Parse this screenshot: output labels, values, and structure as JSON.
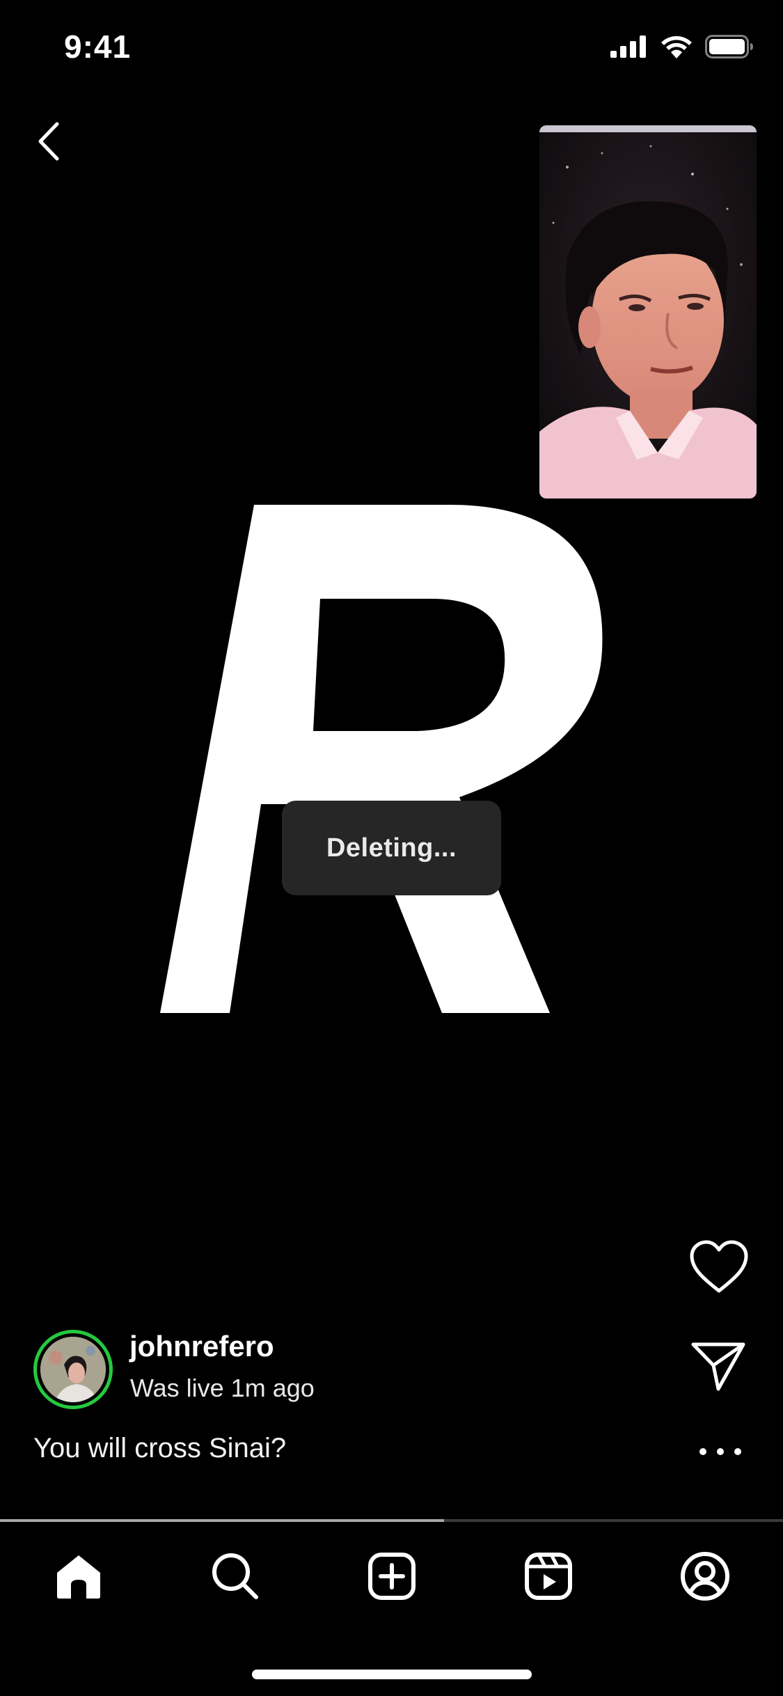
{
  "status_bar": {
    "time": "9:41",
    "icons": [
      "signal-icon",
      "wifi-icon",
      "battery-icon"
    ]
  },
  "navigation": {
    "back_icon": "chevron-left-icon"
  },
  "pip": {
    "description_icon": "pip-video"
  },
  "toast": {
    "text": "Deleting..."
  },
  "actions": {
    "like_icon": "heart-icon",
    "share_icon": "send-icon",
    "more_icon": "more-horizontal-icon"
  },
  "post": {
    "username": "johnrefero",
    "live_status": "Was live 1m ago",
    "caption": "You will cross Sinai?",
    "ring_color": "#25c93f"
  },
  "playback": {
    "progress": 0.567
  },
  "tab_bar": {
    "tabs": [
      {
        "name": "home",
        "icon": "home-icon",
        "active": true
      },
      {
        "name": "search",
        "icon": "search-icon",
        "active": false
      },
      {
        "name": "create",
        "icon": "plus-square-icon",
        "active": false
      },
      {
        "name": "reels",
        "icon": "reels-icon",
        "active": false
      },
      {
        "name": "profile",
        "icon": "profile-icon",
        "active": false
      }
    ]
  }
}
